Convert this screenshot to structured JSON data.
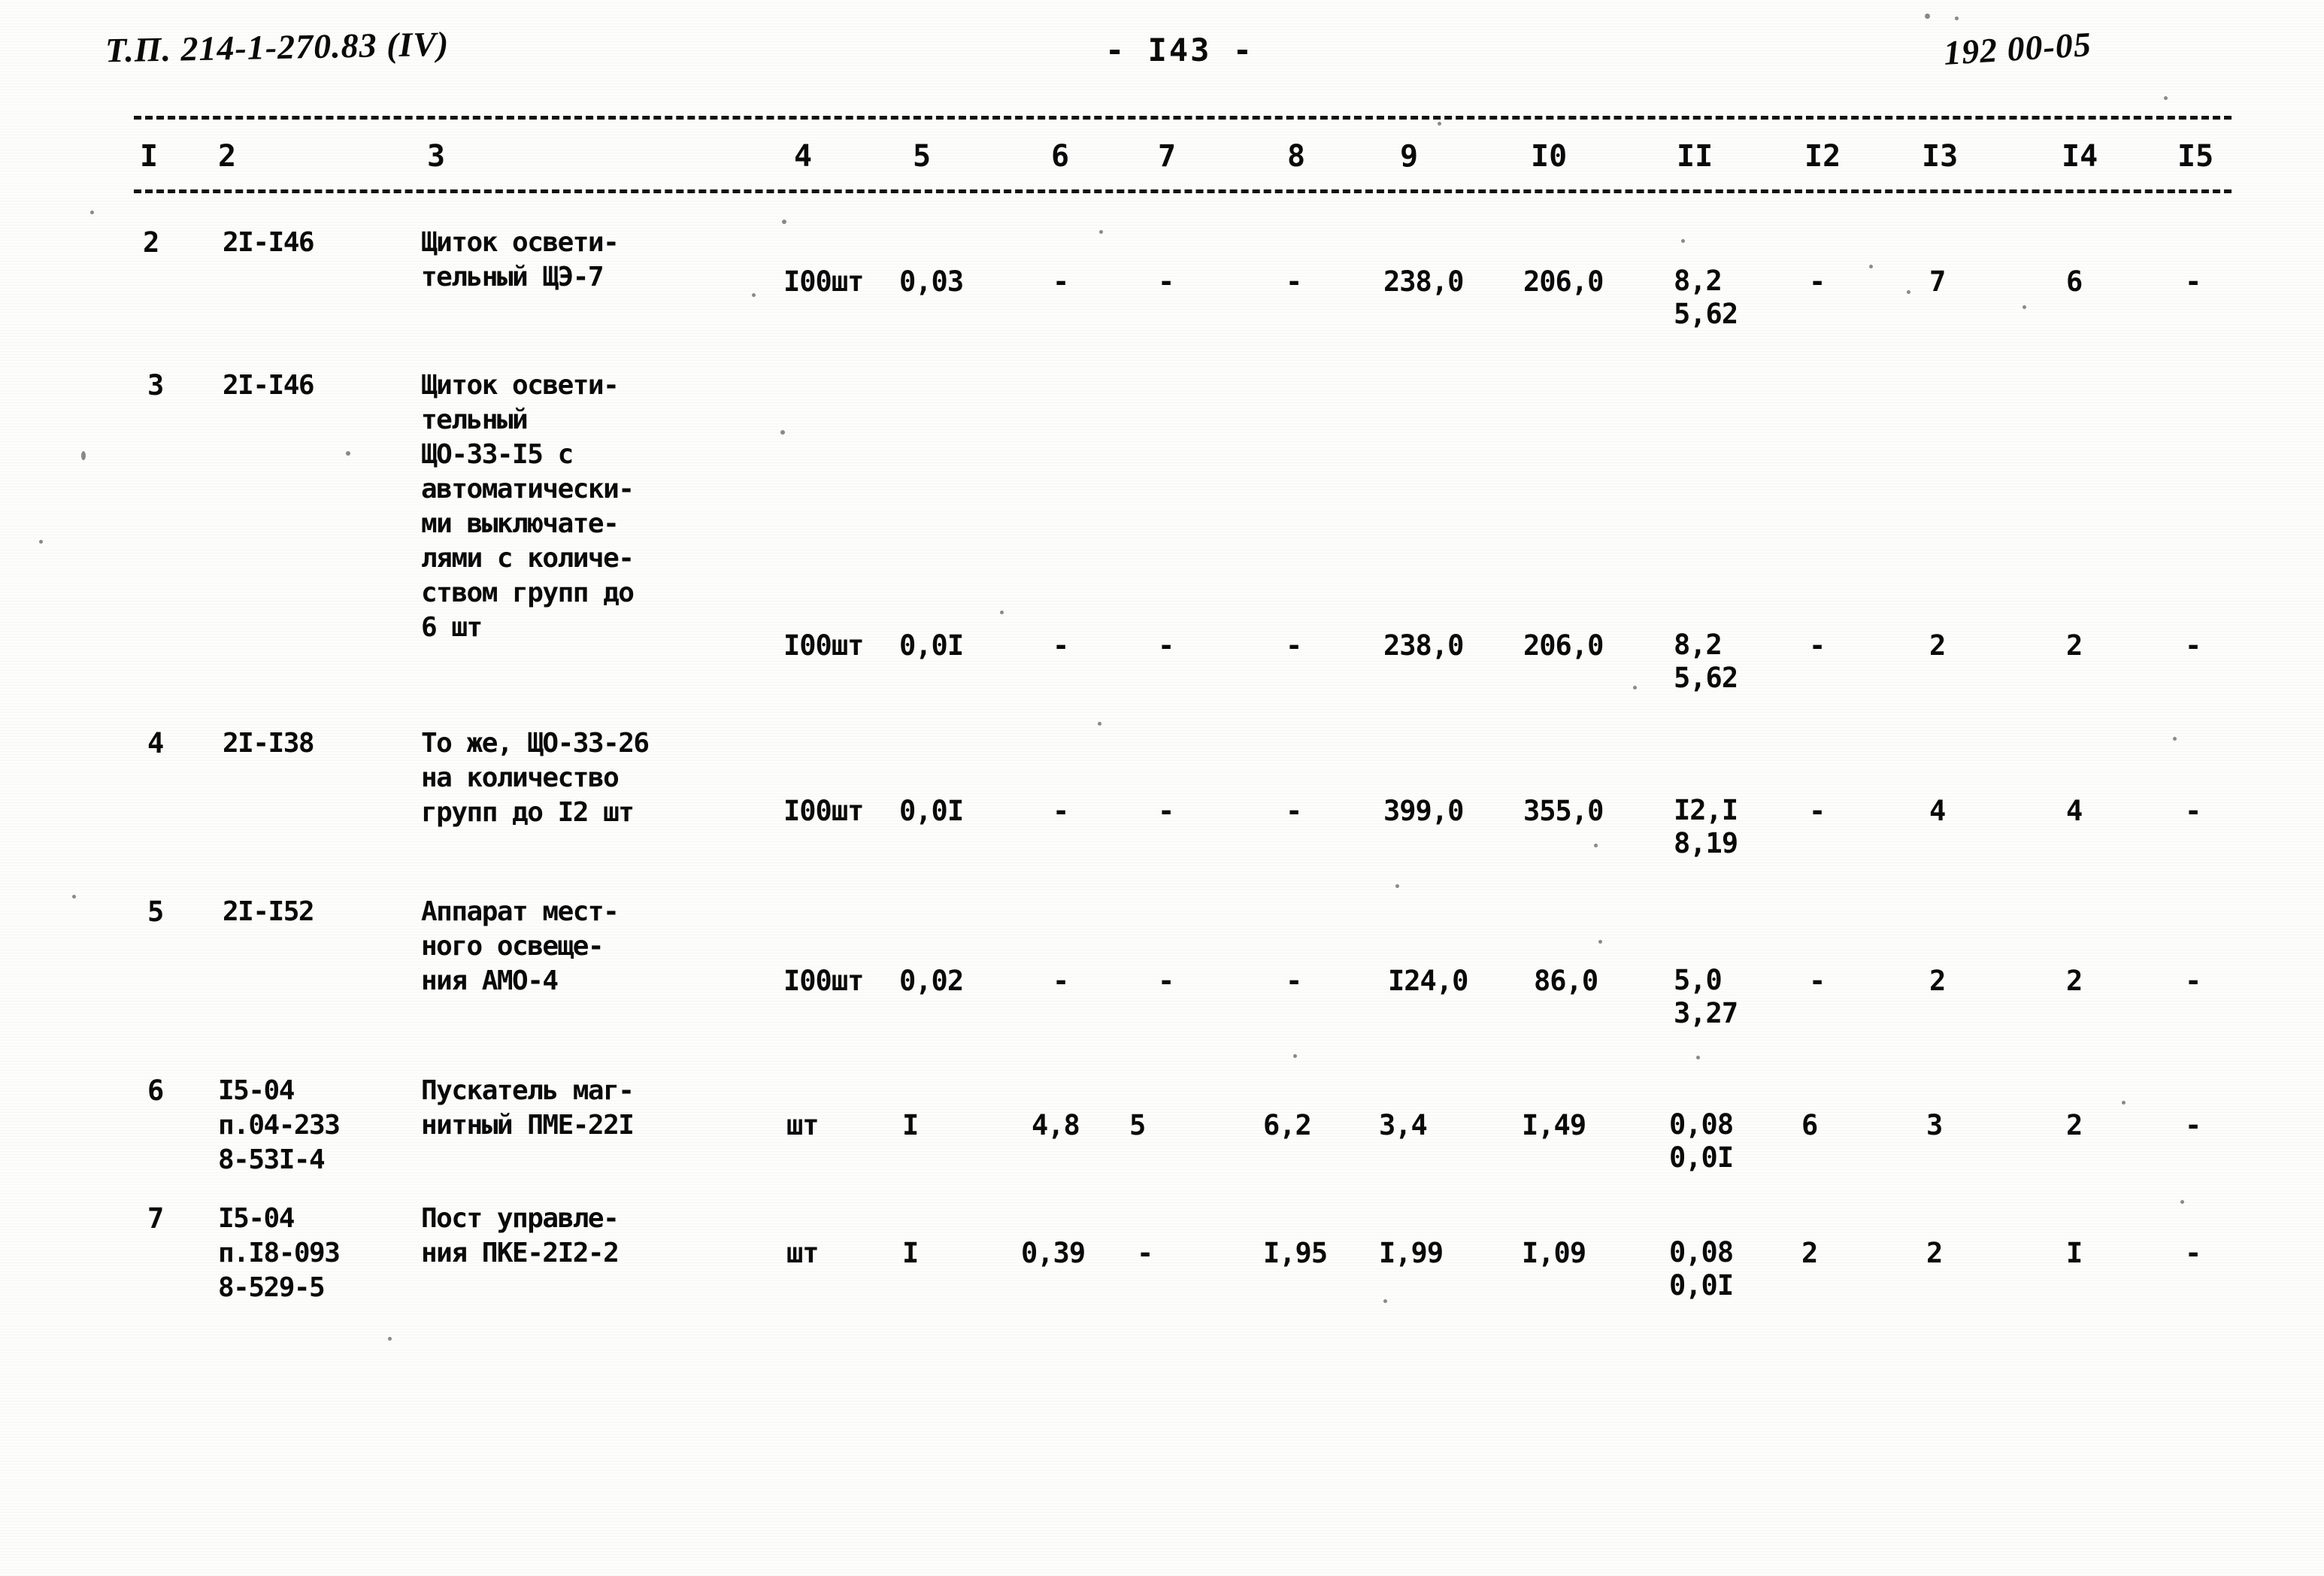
{
  "header": {
    "doc_code": "Т.П. 214-1-270.83 (IV)",
    "page_number": "- I43 -",
    "sheet_code": "192 00-05"
  },
  "table": {
    "column_numbers": [
      "I",
      "2",
      "3",
      "4",
      "5",
      "6",
      "7",
      "8",
      "9",
      "I0",
      "II",
      "I2",
      "I3",
      "I4",
      "I5"
    ],
    "rows": [
      {
        "c1": "2",
        "c2": "2I-I46",
        "c3": "Щиток освети-\nтельный ЩЭ-7",
        "c4": "I00шт",
        "c5": "0,03",
        "c6": "-",
        "c7": "-",
        "c8": "-",
        "c9": "238,0",
        "c10": "206,0",
        "c11a": "8,2",
        "c11b": "5,62",
        "c12": "-",
        "c13": "7",
        "c14": "6",
        "c15": "-"
      },
      {
        "c1": "3",
        "c2": "2I-I46",
        "c3": "Щиток освети-\nтельный\nЩО-33-I5 с\nавтоматически-\nми выключате-\nлями с количе-\nством групп до\n6 шт",
        "c4": "I00шт",
        "c5": "0,0I",
        "c6": "-",
        "c7": "-",
        "c8": "-",
        "c9": "238,0",
        "c10": "206,0",
        "c11a": "8,2",
        "c11b": "5,62",
        "c12": "-",
        "c13": "2",
        "c14": "2",
        "c15": "-"
      },
      {
        "c1": "4",
        "c2": "2I-I38",
        "c3": "То же, ЩО-33-26\nна количество\nгрупп до I2 шт",
        "c4": "I00шт",
        "c5": "0,0I",
        "c6": "-",
        "c7": "-",
        "c8": "-",
        "c9": "399,0",
        "c10": "355,0",
        "c11a": "I2,I",
        "c11b": "8,19",
        "c12": "-",
        "c13": "4",
        "c14": "4",
        "c15": "-"
      },
      {
        "c1": "5",
        "c2": "2I-I52",
        "c3": "Аппарат мест-\nного освеще-\nния АМО-4",
        "c4": "I00шт",
        "c5": "0,02",
        "c6": "-",
        "c7": "-",
        "c8": "-",
        "c9": "I24,0",
        "c10": "86,0",
        "c11a": "5,0",
        "c11b": "3,27",
        "c12": "-",
        "c13": "2",
        "c14": "2",
        "c15": "-"
      },
      {
        "c1": "6",
        "c2": "I5-04\nп.04-233\n8-53I-4",
        "c3": "Пускатель маг-\nнитный ПМЕ-22I",
        "c4": "шт",
        "c5": "I",
        "c6": "4,8",
        "c7": "5",
        "c8": "6,2",
        "c9": "3,4",
        "c10": "I,49",
        "c11a": "0,08",
        "c11b": "0,0I",
        "c12": "6",
        "c13": "3",
        "c14": "2",
        "c15": "-"
      },
      {
        "c1": "7",
        "c2": "I5-04\nп.I8-093\n8-529-5",
        "c3": "Пост управле-\nния ПКЕ-2I2-2",
        "c4": "шт",
        "c5": "I",
        "c6": "0,39",
        "c7": "-",
        "c8": "I,95",
        "c9": "I,99",
        "c10": "I,09",
        "c11a": "0,08",
        "c11b": "0,0I",
        "c12": "2",
        "c13": "2",
        "c14": "I",
        "c15": "-"
      }
    ]
  }
}
